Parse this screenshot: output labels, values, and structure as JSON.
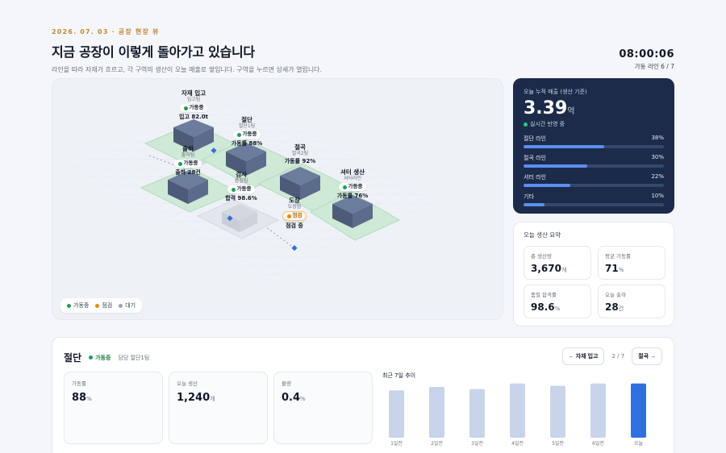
{
  "header": {
    "eyebrow": "2026. 07. 03 · 공장 현장 뷰",
    "title": "지금 공장이 이렇게 돌아가고 있습니다",
    "subtitle": "라인을 따라 자재가 흐르고, 각 구역의 생산이 오늘 매출로 쌓입니다. 구역을 누르면 상세가 열립니다.",
    "clock": "08:00:06",
    "line_status": "가동 라인 6 / 7"
  },
  "colors": {
    "ok": "#1f9d55",
    "warn": "#e08a1e",
    "idle": "#9aa3b2",
    "accent": "#2f6fe0",
    "navy": "#1c2b4a"
  },
  "zones": [
    {
      "name": "자재 입고",
      "sub": "입고팀",
      "status": "가동중",
      "metric": "입고 82.0t",
      "kind": "ok"
    },
    {
      "name": "절단",
      "sub": "절단1팀",
      "status": "가동중",
      "metric": "가동률 88%",
      "kind": "ok"
    },
    {
      "name": "출하",
      "sub": "출하팀",
      "status": "가동중",
      "metric": "출하 28건",
      "kind": "ok"
    },
    {
      "name": "절곡",
      "sub": "절곡2팀",
      "status": "",
      "metric": "가동률 92%",
      "kind": "ok"
    },
    {
      "name": "검사",
      "sub": "품질팀",
      "status": "가동중",
      "metric": "합격 98.6%",
      "kind": "ok"
    },
    {
      "name": "도장",
      "sub": "도장팀",
      "status": "점검",
      "metric": "점검 중",
      "kind": "warn"
    },
    {
      "name": "셔터 생산",
      "sub": "셔터라인",
      "status": "가동중",
      "metric": "가동률 76%",
      "kind": "ok"
    }
  ],
  "legend": [
    {
      "label": "가동중",
      "color": "#1f9d55"
    },
    {
      "label": "점검",
      "color": "#e08a1e"
    },
    {
      "label": "대기",
      "color": "#9aa3b2"
    }
  ],
  "revenue": {
    "label": "오늘 누적 매출 (생산 기준)",
    "value": "3.39",
    "unit": "억",
    "live": "실시간 반영 중",
    "rows": [
      {
        "name": "절단 라인",
        "pct": "38%",
        "fraction": 0.38
      },
      {
        "name": "절곡 라인",
        "pct": "30%",
        "fraction": 0.3
      },
      {
        "name": "셔터 라인",
        "pct": "22%",
        "fraction": 0.22
      },
      {
        "name": "기타",
        "pct": "10%",
        "fraction": 0.1
      }
    ]
  },
  "summary": {
    "title": "오늘 생산 요약",
    "items": [
      {
        "label": "총 생산량",
        "value": "3,670",
        "unit": "개"
      },
      {
        "label": "평균 가동률",
        "value": "71",
        "unit": "%"
      },
      {
        "label": "품질 합격률",
        "value": "98.6",
        "unit": "%"
      },
      {
        "label": "오늘 출하",
        "value": "28",
        "unit": "건"
      }
    ]
  },
  "detail": {
    "title": "절단",
    "status": "가동중",
    "team": "담당 절단1팀",
    "prev": "← 자재 입고",
    "page": "2 / 7",
    "next": "절곡 →",
    "kpis": [
      {
        "label": "가동률",
        "value": "88",
        "unit": "%"
      },
      {
        "label": "오늘 생산",
        "value": "1,240",
        "unit": "개"
      },
      {
        "label": "불량",
        "value": "0.4",
        "unit": "%"
      }
    ],
    "trend_title": "최근 7일 추이",
    "chart_data": {
      "type": "bar",
      "categories": [
        "1일전",
        "2일전",
        "3일전",
        "4일전",
        "5일전",
        "6일전",
        "오늘"
      ],
      "values": [
        84,
        90,
        86,
        96,
        92,
        96,
        96
      ],
      "highlight_index": 6
    }
  }
}
